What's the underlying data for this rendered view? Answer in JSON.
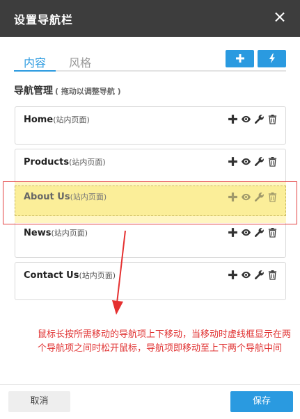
{
  "dialog": {
    "title": "设置导航栏"
  },
  "tabs": [
    {
      "label": "内容",
      "active": true
    },
    {
      "label": "风格",
      "active": false
    }
  ],
  "toolbar": {
    "add_icon": "plus-icon",
    "quick_icon": "lightning-icon"
  },
  "section": {
    "title": "导航管理",
    "hint": "( 拖动以调整导航 )"
  },
  "nav_items": [
    {
      "name": "Home",
      "type": "(站内页面)"
    },
    {
      "name": "Products",
      "type": "(站内页面)"
    },
    {
      "name": "News",
      "type": "(站内页面)"
    },
    {
      "name": "Contact Us",
      "type": "(站内页面)"
    }
  ],
  "dragging_item": {
    "name": "About Us",
    "type": "(站内页面)"
  },
  "item_actions": [
    "plus-icon",
    "eye-icon",
    "wrench-icon",
    "trash-icon"
  ],
  "annotation": "鼠标长按所需移动的导航项上下移动，当移动时虚线框显示在两个导航项之间时松开鼠标，导航项即移动至上下两个导航中间",
  "footer": {
    "cancel_label": "取消",
    "save_label": "保存"
  },
  "colors": {
    "accent": "#2a9ae0",
    "header": "#3d3d3d",
    "drag_highlight": "#fbee99",
    "annotation": "#e03030"
  }
}
